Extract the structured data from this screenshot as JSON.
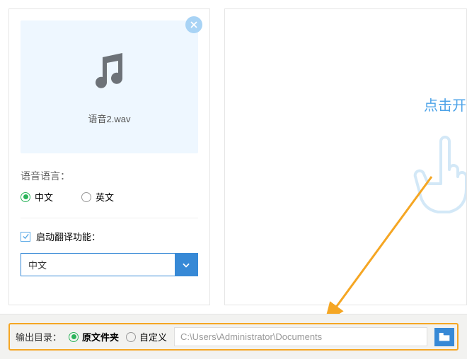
{
  "file": {
    "name": "语音2.wav"
  },
  "language": {
    "section_label": "语音语言：",
    "option_chinese": "中文",
    "option_english": "英文",
    "selected": "chinese"
  },
  "translate": {
    "checkbox_label": "启动翻译功能：",
    "checked": true,
    "select_value": "中文"
  },
  "right_panel": {
    "action_text": "点击开"
  },
  "output": {
    "label": "输出目录：",
    "option_original": "原文件夹",
    "option_custom": "自定义",
    "selected": "original",
    "path_placeholder": "C:\\Users\\Administrator\\Documents"
  },
  "colors": {
    "accent_blue": "#3789d6",
    "light_blue": "#eef7ff",
    "green": "#2bb35a",
    "orange": "#f5a623"
  }
}
